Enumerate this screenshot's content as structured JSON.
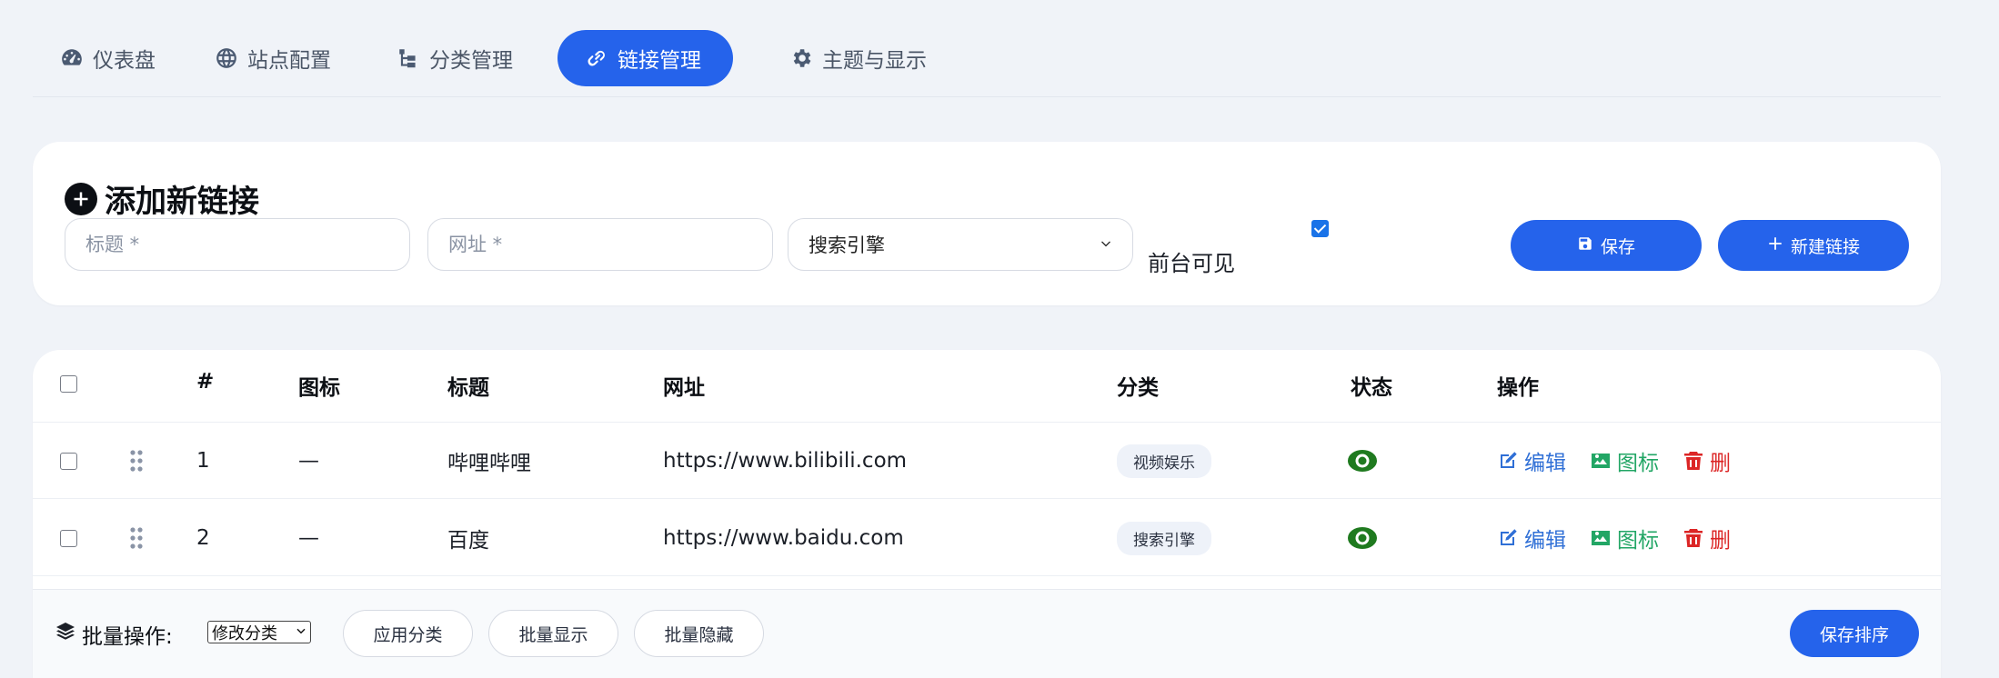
{
  "nav": {
    "items": [
      {
        "label": "仪表盘",
        "icon": "gauge-icon"
      },
      {
        "label": "站点配置",
        "icon": "globe-icon"
      },
      {
        "label": "分类管理",
        "icon": "sitemap-icon"
      },
      {
        "label": "链接管理",
        "icon": "link-icon",
        "active": true
      },
      {
        "label": "主题与显示",
        "icon": "gear-icon"
      }
    ]
  },
  "add_form": {
    "title": "添加新链接",
    "title_placeholder": "标题 *",
    "url_placeholder": "网址 *",
    "category_value": "搜索引擎",
    "visible_label": "前台可见",
    "visible_checked": true,
    "save_label": "保存",
    "new_label": "新建链接"
  },
  "table": {
    "headers": {
      "index": "#",
      "icon": "图标",
      "title": "标题",
      "url": "网址",
      "category": "分类",
      "status": "状态",
      "actions": "操作"
    },
    "rows": [
      {
        "index": "1",
        "icon": "—",
        "title": "哔哩哔哩",
        "url": "https://www.bilibili.com",
        "category": "视频娱乐",
        "status_icon": "eye-icon"
      },
      {
        "index": "2",
        "icon": "—",
        "title": "百度",
        "url": "https://www.baidu.com",
        "category": "搜索引擎",
        "status_icon": "eye-icon"
      }
    ],
    "actions": {
      "edit": "编辑",
      "icon": "图标",
      "delete": "删"
    }
  },
  "batch": {
    "label": "批量操作:",
    "select_value": "修改分类",
    "apply_category": "应用分类",
    "batch_show": "批量显示",
    "batch_hide": "批量隐藏",
    "save_order": "保存排序"
  },
  "colors": {
    "accent": "#2563eb",
    "edit": "#2f6fd6",
    "icon_action": "#22a665",
    "delete": "#dc2626",
    "status_visible": "#1f7a1f"
  }
}
